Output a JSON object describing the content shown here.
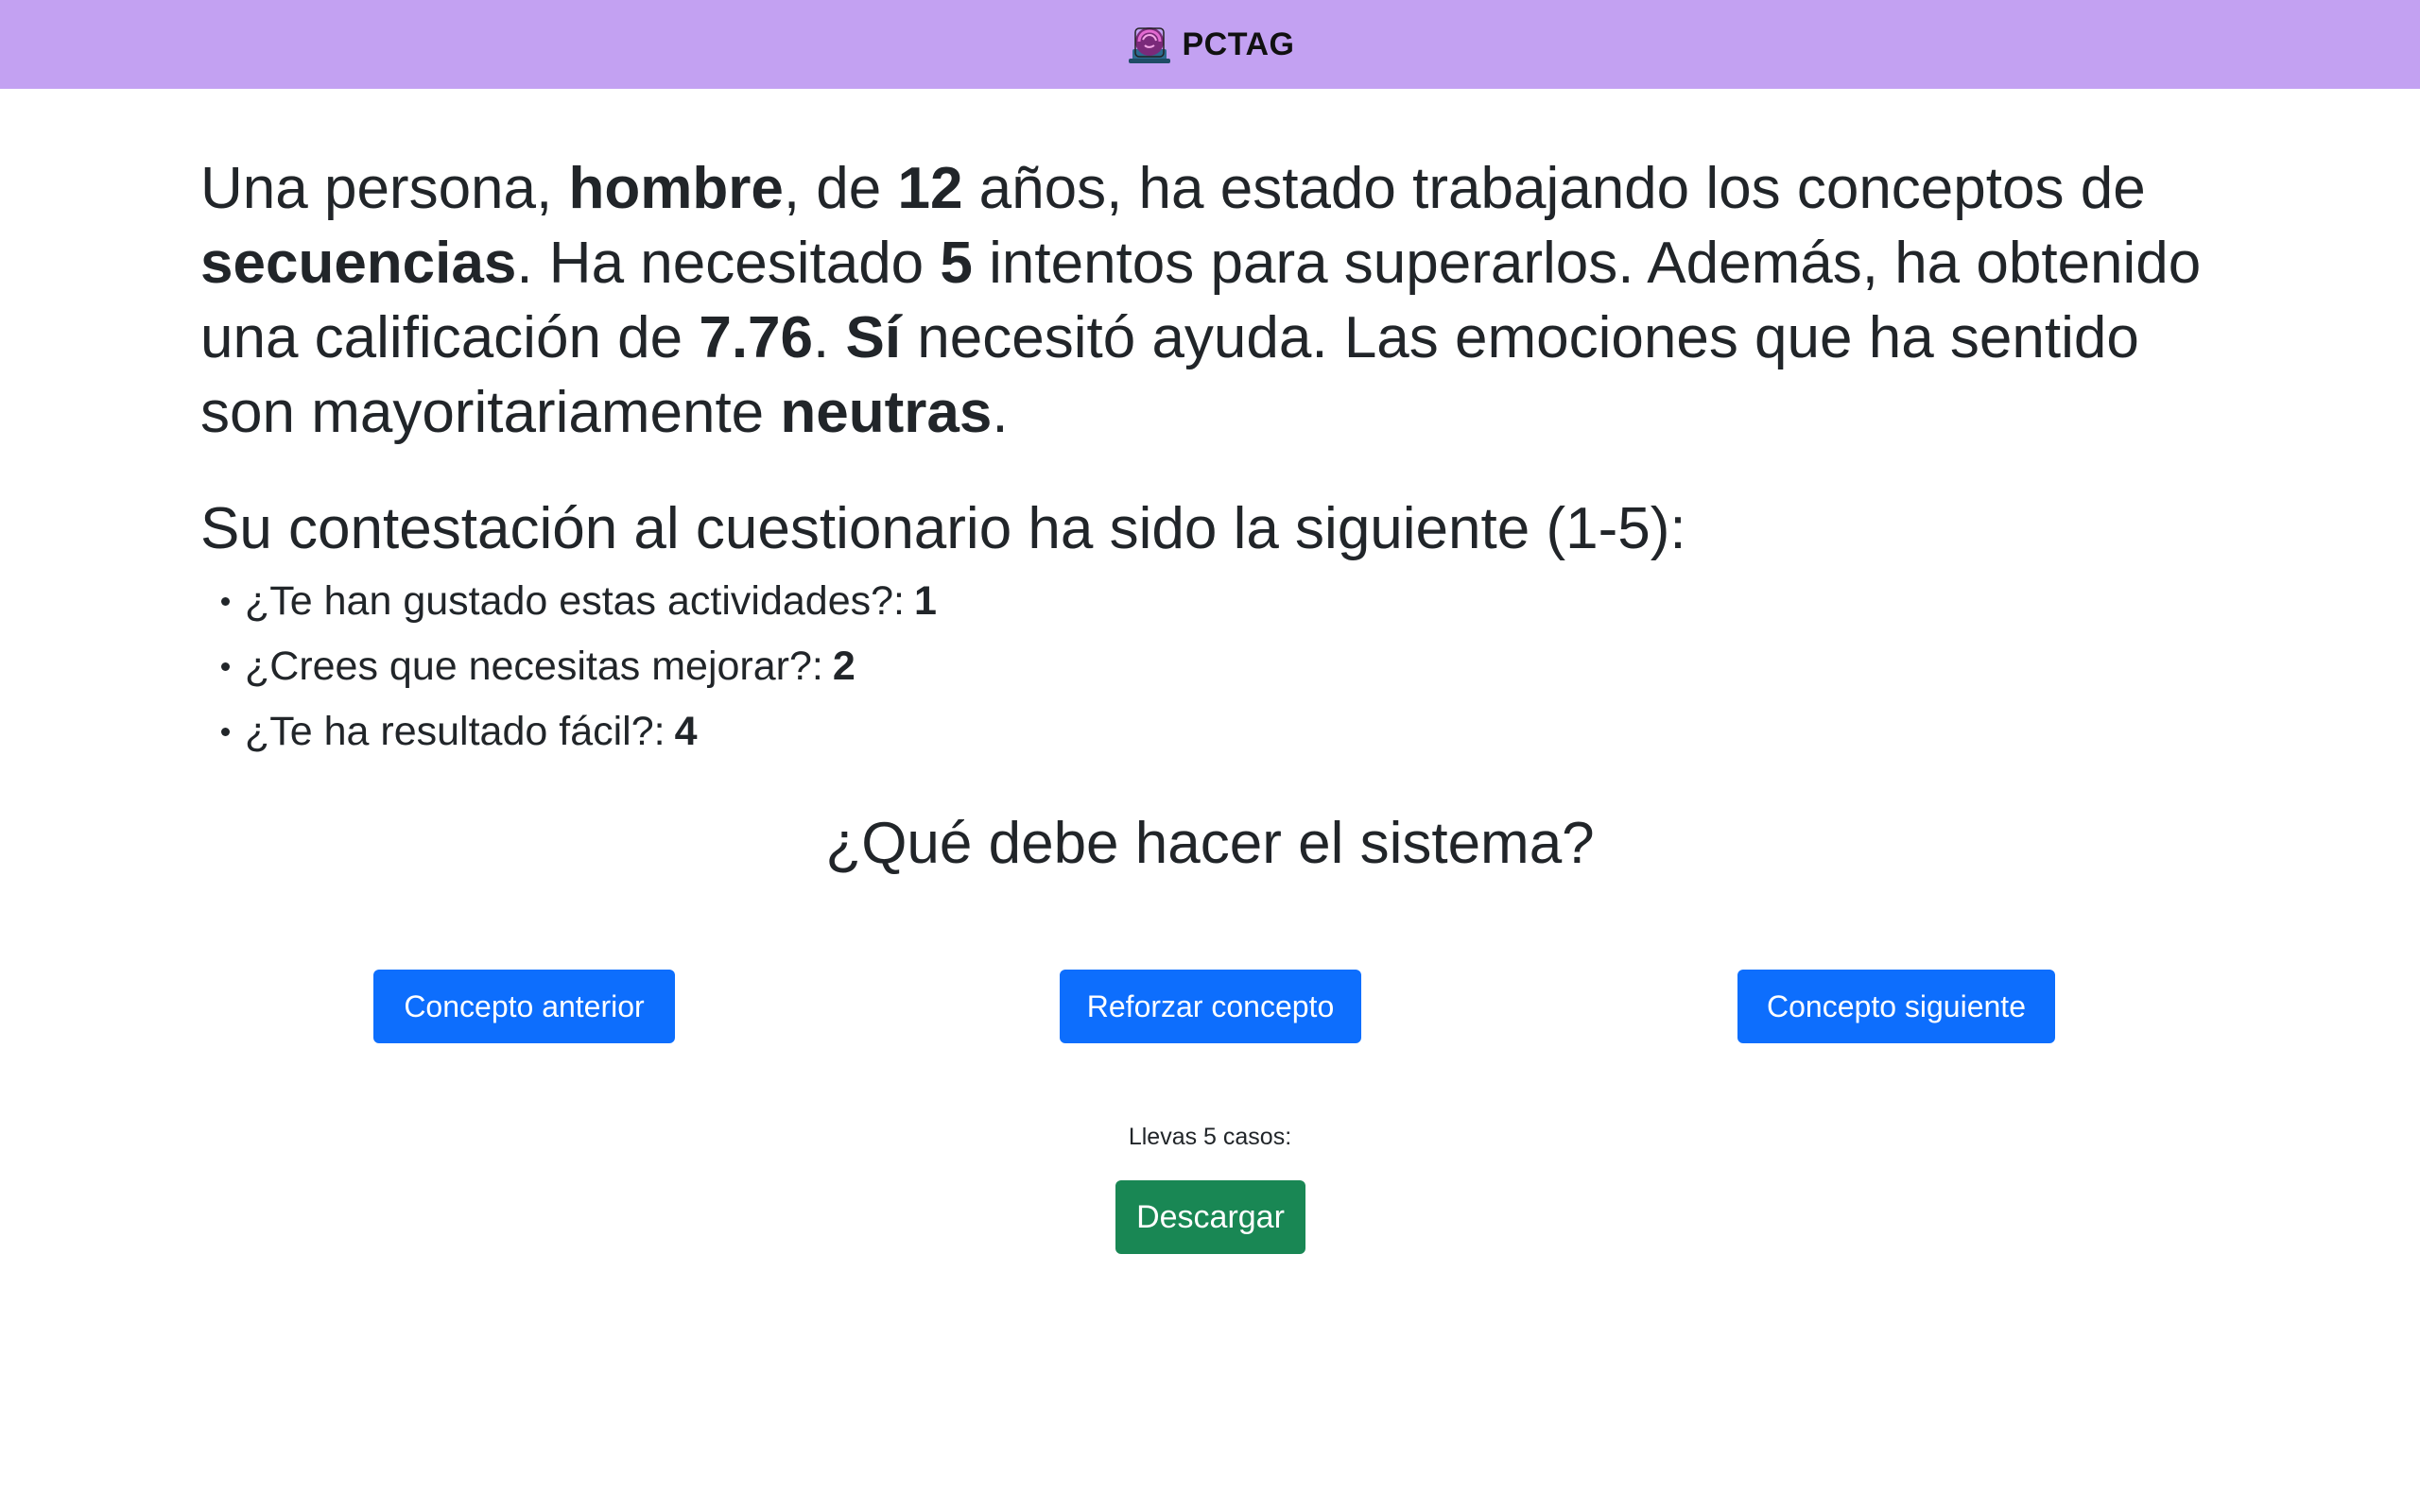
{
  "header": {
    "brand_name": "PCTAG",
    "logo_icon": "brain-laptop-logo",
    "background_color": "#c3a1f2"
  },
  "case": {
    "t1": "Una persona, ",
    "gender": "hombre",
    "t2": ", de ",
    "age": "12",
    "t3": " años, ha estado trabajando los conceptos de ",
    "concept": "secuencias",
    "t4": ". Ha necesitado ",
    "attempts": "5",
    "t5": " intentos para superarlos. Además, ha obtenido una calificación de ",
    "grade": "7.76",
    "t6": ". ",
    "needed_help": "Sí",
    "t7": " necesitó ayuda. Las emociones que ha sentido son mayoritariamente ",
    "emotion": "neutras",
    "t8": "."
  },
  "questionnaire": {
    "title": "Su contestación al cuestionario ha sido la siguiente (1-5):",
    "items": [
      {
        "question": "¿Te han gustado estas actividades?:",
        "answer": "1"
      },
      {
        "question": "¿Crees que necesitas mejorar?:",
        "answer": "2"
      },
      {
        "question": "¿Te ha resultado fácil?:",
        "answer": "4"
      }
    ]
  },
  "decision": {
    "question": "¿Qué debe hacer el sistema?",
    "buttons": {
      "previous": "Concepto anterior",
      "reinforce": "Reforzar concepto",
      "next": "Concepto siguiente"
    },
    "primary_color": "#0d6efd"
  },
  "footer": {
    "counter_text": "Llevas 5 casos:",
    "download_label": "Descargar",
    "download_color": "#198754"
  }
}
